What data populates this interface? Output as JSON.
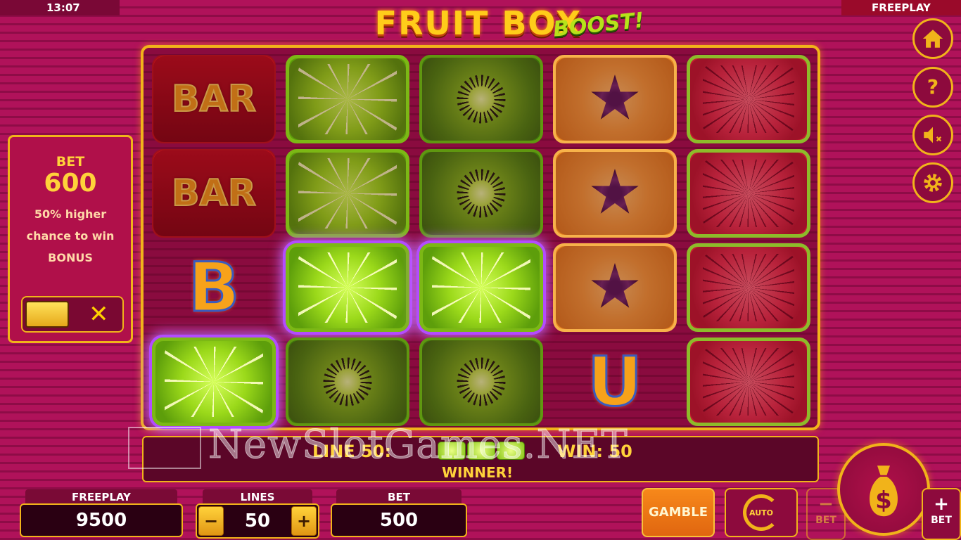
{
  "status_bar": {
    "time": "13:07",
    "mode": "FREEPLAY"
  },
  "logo": {
    "main": "FRUIT BOX",
    "sub": "BOOST!"
  },
  "side_buttons": [
    "home-icon",
    "help-icon",
    "sound-muted-icon",
    "settings-icon"
  ],
  "reels": {
    "rows": [
      [
        {
          "symbol": "bar",
          "label": "BAR",
          "win": false
        },
        {
          "symbol": "lime",
          "win": false
        },
        {
          "symbol": "kiwi",
          "win": false
        },
        {
          "symbol": "orange",
          "win": false
        },
        {
          "symbol": "watermelon",
          "win": false
        }
      ],
      [
        {
          "symbol": "bar",
          "label": "BAR",
          "win": false
        },
        {
          "symbol": "lime",
          "win": false
        },
        {
          "symbol": "kiwi",
          "win": false
        },
        {
          "symbol": "orange",
          "win": false
        },
        {
          "symbol": "watermelon",
          "win": false
        }
      ],
      [
        {
          "symbol": "letter",
          "label": "B",
          "win": false
        },
        {
          "symbol": "lime",
          "win": true
        },
        {
          "symbol": "lime",
          "win": true
        },
        {
          "symbol": "orange",
          "win": false
        },
        {
          "symbol": "watermelon",
          "win": false
        }
      ],
      [
        {
          "symbol": "lime",
          "win": true
        },
        {
          "symbol": "kiwi",
          "win": false
        },
        {
          "symbol": "kiwi",
          "win": false
        },
        {
          "symbol": "letter",
          "label": "U",
          "win": false
        },
        {
          "symbol": "watermelon",
          "win": false
        }
      ]
    ]
  },
  "bet_boost_panel": {
    "title": "BET",
    "value": "600",
    "line1": "50% higher",
    "line2": "chance to win",
    "line3": "BONUS",
    "toggle_off_symbol": "✕"
  },
  "win_info": {
    "line_text": "LINE 50:",
    "win_text": "WIN: 50",
    "winner_text": "WINNER!",
    "line_symbols": [
      "lime",
      "lime",
      "lime"
    ]
  },
  "watermark": {
    "text": "NewSlotGames.NET"
  },
  "bottom": {
    "freeplay_label": "FREEPLAY",
    "freeplay_value": "9500",
    "lines_label": "LINES",
    "lines_value": "50",
    "lines_minus": "−",
    "lines_plus": "+",
    "bet_label": "BET",
    "bet_value": "500",
    "gamble_label": "GAMBLE",
    "auto_label": "AUTO",
    "bet_minus_symbol": "−",
    "bet_minus_label": "BET",
    "bet_plus_symbol": "+",
    "bet_plus_label": "BET"
  },
  "colors": {
    "accent": "#f1b31a",
    "background": "#b0125a",
    "win_glow": "#c36bff"
  }
}
